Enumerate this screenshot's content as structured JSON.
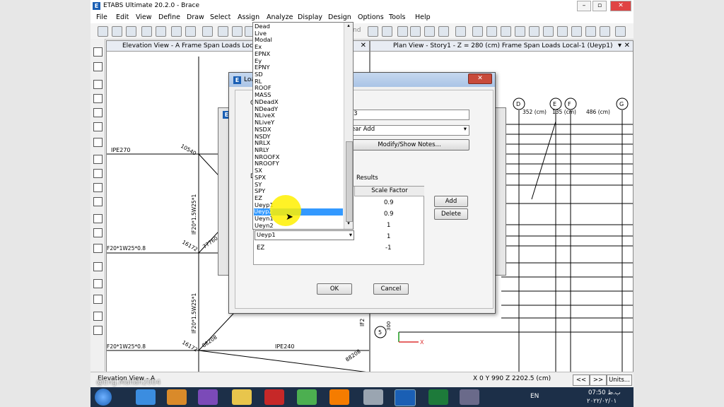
{
  "app": {
    "title": "ETABS Ultimate 20.2.0 - Brace",
    "logo": "E"
  },
  "window_buttons": [
    "–",
    "▫",
    "✕"
  ],
  "menu": [
    "File",
    "Edit",
    "View",
    "Define",
    "Draw",
    "Select",
    "Assign",
    "Analyze",
    "Display",
    "Design",
    "Options",
    "Tools",
    "Help"
  ],
  "toolbar_nd": "nd",
  "views": {
    "left_title": "Elevation View - A  Frame Span Loads Local-1",
    "right_title": "Plan View - Story1 - Z = 280 (cm)  Frame Span Loads Local-1 (Ueyp1)",
    "close": "✕"
  },
  "elevation_labels": {
    "ipe270": "IPE270",
    "v10540": "10540",
    "if1": "IF20*1.5W25*1",
    "if2": "IF20*1.5W25*1",
    "f1": "F20*1W25*0.8",
    "f2": "F20*1W25*0.8",
    "v16172a": "16172",
    "v77760": "77760",
    "v16172b": "16172",
    "v88208a": "88208",
    "ipe240": "IPE240",
    "v88208b": "88208",
    "if3": "IF2"
  },
  "plan_labels": {
    "gD": "D",
    "gE": "E",
    "gF": "F",
    "gG": "G",
    "d352": "352 (cm)",
    "d135": "135 (cm)",
    "d486": "486 (cm)",
    "g5": "5",
    "v300": "300",
    "x": "X"
  },
  "dialog": {
    "title": "Load",
    "title_g": "G",
    "title_d": "D",
    "close": "✕",
    "combo_name": "-3",
    "combo_type": "ear Add",
    "modify_notes": "Modify/Show Notes...",
    "results": "Results",
    "scale_factor_header": "Scale Factor",
    "rows": [
      {
        "case": "",
        "factor": "0.9"
      },
      {
        "case": "",
        "factor": "0.9"
      },
      {
        "case": "",
        "factor": "1"
      },
      {
        "case": "Ueyp1",
        "factor": "1"
      },
      {
        "case": "EZ",
        "factor": "-1"
      }
    ],
    "add": "Add",
    "delete": "Delete",
    "ok": "OK",
    "cancel": "Cancel"
  },
  "dropdown": {
    "options": [
      "Dead",
      "Live",
      "Modal",
      "Ex",
      "EPNX",
      "Ey",
      "EPNY",
      "SD",
      "RL",
      "ROOF",
      "MASS",
      "NDeadX",
      "NDeadY",
      "NLiveX",
      "NLiveY",
      "NSDX",
      "NSDY",
      "NRLX",
      "NRLY",
      "NROOFX",
      "NROOFY",
      "SX",
      "SPX",
      "SY",
      "SPY",
      "EZ",
      "Ueyp1",
      "Ueyp2",
      "Ueyn1",
      "Ueyn2"
    ],
    "selected": "Ueyp2"
  },
  "status": {
    "view": "Elevation View - A",
    "coords": "X 0  Y 990  Z 2202.5 (cm)",
    "prev": "<<",
    "next": ">>",
    "units": "Units..."
  },
  "watermark": "@Eng.Mahan2004",
  "taskbar": {
    "lang": "EN",
    "time": "07:50 ب.ظ",
    "date": "۲۰۲۲/۰۲/۰۱"
  },
  "colors": {
    "selection": "#3399ff",
    "highlight": "#ffee00",
    "taskbar": "#1c2f48",
    "title_gradient": "#aac4e6"
  }
}
